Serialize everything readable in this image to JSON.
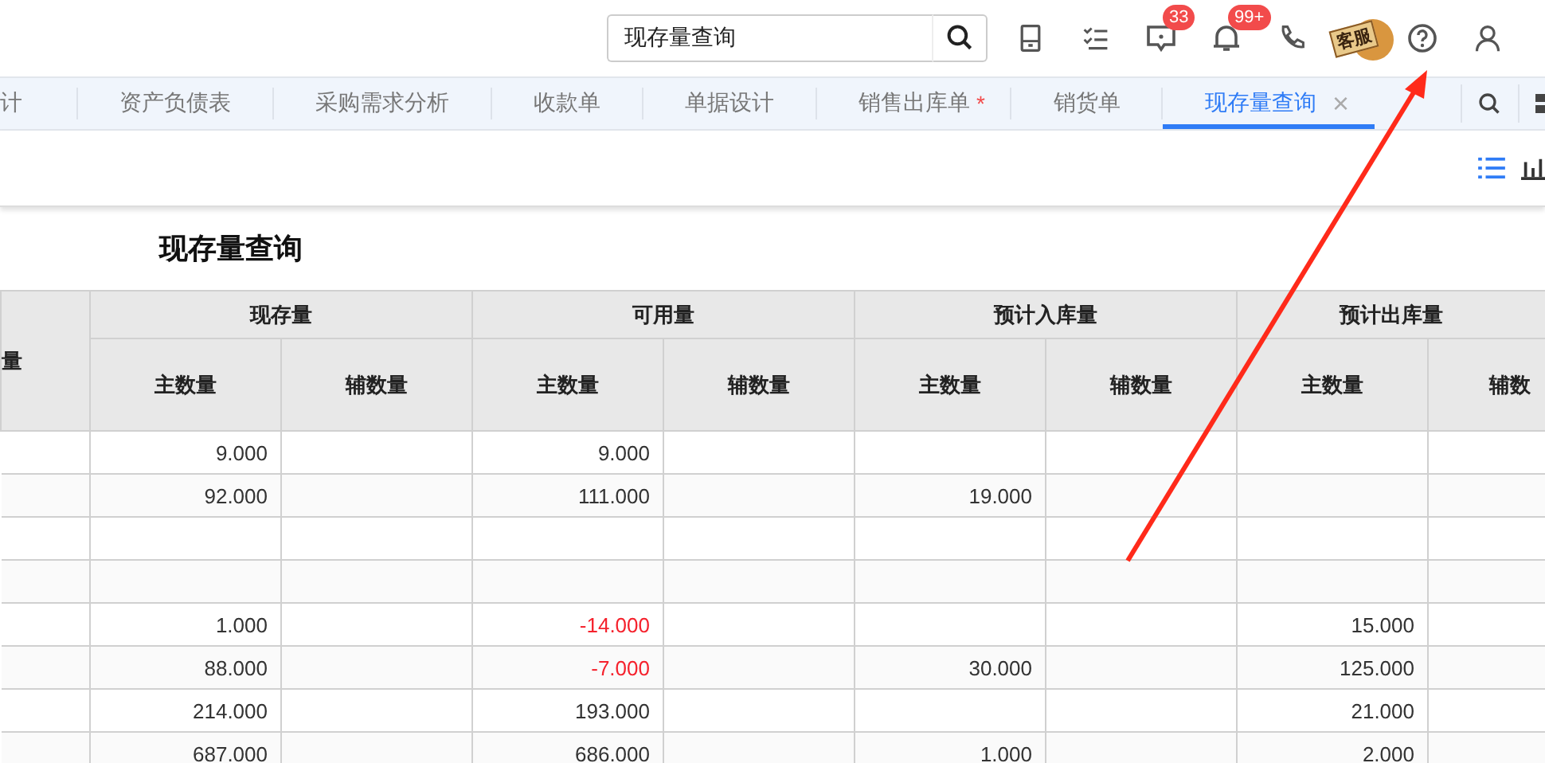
{
  "search": {
    "value": "现存量查询"
  },
  "header_icons": [
    {
      "kind": "mobile"
    },
    {
      "kind": "checklist"
    },
    {
      "kind": "message",
      "badge": "33"
    },
    {
      "kind": "bell",
      "badge": "99+"
    },
    {
      "kind": "phone"
    },
    {
      "kind": "support",
      "label": "客服"
    },
    {
      "kind": "help"
    },
    {
      "kind": "user"
    }
  ],
  "tabs": [
    {
      "label": "计",
      "selected": false,
      "modified": false,
      "closable": false
    },
    {
      "label": "资产负债表",
      "selected": false,
      "modified": false,
      "closable": false
    },
    {
      "label": "采购需求分析",
      "selected": false,
      "modified": false,
      "closable": false
    },
    {
      "label": "收款单",
      "selected": false,
      "modified": false,
      "closable": false
    },
    {
      "label": "单据设计",
      "selected": false,
      "modified": false,
      "closable": false
    },
    {
      "label": "销售出库单",
      "selected": false,
      "modified": true,
      "closable": false
    },
    {
      "label": "销货单",
      "selected": false,
      "modified": false,
      "closable": false
    },
    {
      "label": "现存量查询",
      "selected": true,
      "modified": false,
      "closable": true
    }
  ],
  "modified_mark": "*",
  "close_mark": "×",
  "view_toggle": [
    {
      "kind": "list",
      "selected": true
    },
    {
      "kind": "chart",
      "selected": false
    }
  ],
  "page_title": "现存量查询",
  "table": {
    "first_column": "量",
    "groups": [
      {
        "label": "现存量",
        "columns": [
          "主数量",
          "辅数量"
        ]
      },
      {
        "label": "可用量",
        "columns": [
          "主数量",
          "辅数量"
        ]
      },
      {
        "label": "预计入库量",
        "columns": [
          "主数量",
          "辅数量"
        ]
      },
      {
        "label": "预计出库量",
        "columns": [
          "主数量",
          "辅数"
        ]
      }
    ],
    "rows": [
      {
        "cells": [
          {
            "text": "9.000",
            "negative": false
          },
          null,
          {
            "text": "9.000",
            "negative": false
          },
          null,
          null,
          null,
          null,
          null
        ]
      },
      {
        "cells": [
          {
            "text": "92.000",
            "negative": false
          },
          null,
          {
            "text": "111.000",
            "negative": false
          },
          null,
          {
            "text": "19.000",
            "negative": false
          },
          null,
          null,
          null
        ]
      },
      {
        "cells": [
          null,
          null,
          null,
          null,
          null,
          null,
          null,
          null
        ]
      },
      {
        "cells": [
          null,
          null,
          null,
          null,
          null,
          null,
          null,
          null
        ]
      },
      {
        "cells": [
          {
            "text": "1.000",
            "negative": false
          },
          null,
          {
            "text": "-14.000",
            "negative": true
          },
          null,
          null,
          null,
          {
            "text": "15.000",
            "negative": false
          },
          null
        ]
      },
      {
        "cells": [
          {
            "text": "88.000",
            "negative": false
          },
          null,
          {
            "text": "-7.000",
            "negative": true
          },
          null,
          {
            "text": "30.000",
            "negative": false
          },
          null,
          {
            "text": "125.000",
            "negative": false
          },
          null
        ]
      },
      {
        "cells": [
          {
            "text": "214.000",
            "negative": false
          },
          null,
          {
            "text": "193.000",
            "negative": false
          },
          null,
          null,
          null,
          {
            "text": "21.000",
            "negative": false
          },
          null
        ]
      },
      {
        "cells": [
          {
            "text": "687.000",
            "negative": false
          },
          null,
          {
            "text": "686.000",
            "negative": false
          },
          null,
          {
            "text": "1.000",
            "negative": false
          },
          null,
          {
            "text": "2.000",
            "negative": false
          },
          null
        ]
      }
    ]
  }
}
